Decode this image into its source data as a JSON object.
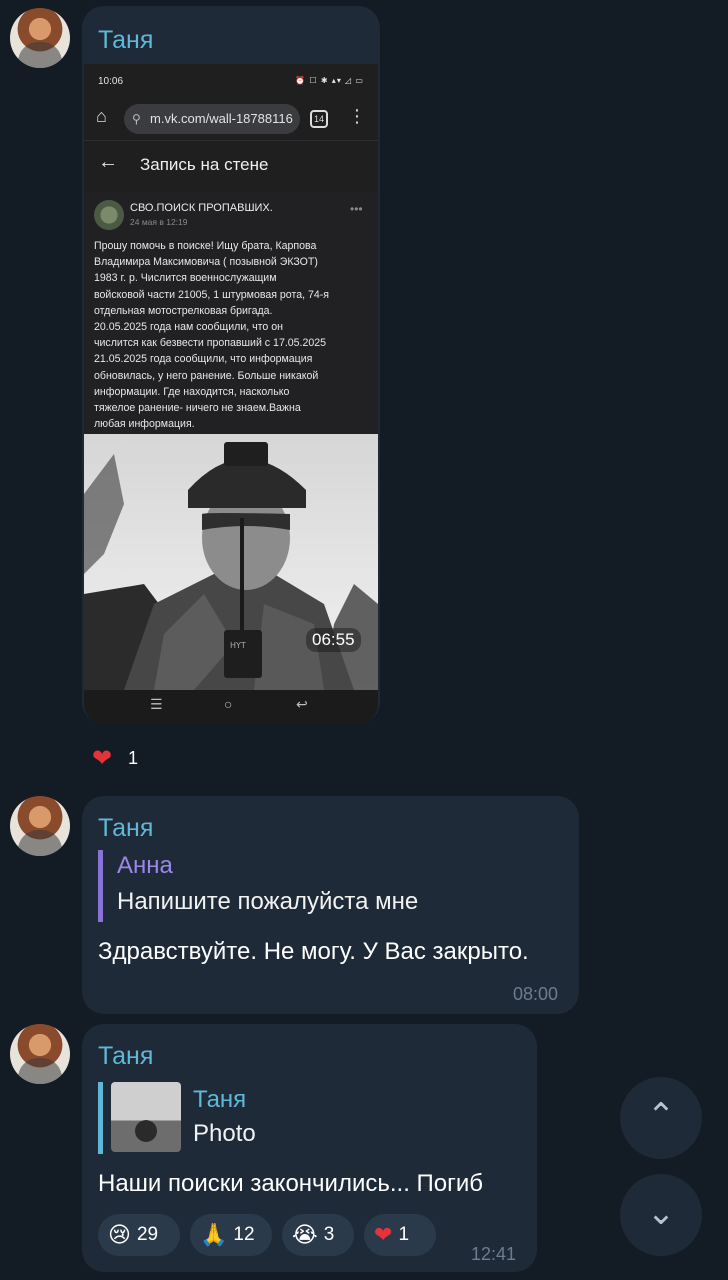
{
  "colors": {
    "background": "#131b24",
    "bubble": "#1e2a38",
    "sender": "#5fb8d8",
    "reply_accent": "#8a73d6",
    "time": "#6d7d8e",
    "heart": "#e5323b"
  },
  "messages": [
    {
      "sender": "Таня",
      "screenshot": {
        "status_time": "10:06",
        "status_icons": "⏰ ☐ ✱ ▴▾ ◿ ▭",
        "url": "m.vk.com/wall-18788116",
        "tabs_count": "14",
        "page_title": "Запись на стене",
        "group_name": "СВО.ПОИСК ПРОПАВШИХ.",
        "post_date": "24 мая в 12:19",
        "post_text": "Прошу помочь в поиске! Ищу брата, Карпова\nВладимира Максимовича ( позывной ЭКЗОТ)\n1983 г. р. Числится военнослужащим\nвойсковой части 21005, 1 штурмовая рота, 74-я\nотдельная мотострелковая бригада.\n20.05.2025 года нам сообщили, что он\nчислится как безвести пропавший с 17.05.2025\n21.05.2025 года сообщили, что информация\nобновилась, у него ранение. Больше никакой\nинформации. Где находится, насколько\nтяжелое ранение- ничего не знаем.Важна\nлюбая информация.",
        "duration": "06:55"
      },
      "reactions": [
        {
          "icon": "heart-icon",
          "emoji": "❤",
          "count": "1"
        }
      ]
    },
    {
      "sender": "Таня",
      "reply_to": {
        "name": "Анна",
        "text": "Напишите пожалуйста мне"
      },
      "text": "Здравствуйте. Не могу. У Вас закрыто.",
      "time": "08:00"
    },
    {
      "sender": "Таня",
      "reply_to": {
        "name": "Таня",
        "text": "Photo"
      },
      "text": "Наши поиски закончились... Погиб",
      "time": "12:41",
      "reactions": [
        {
          "icon": "crying-face-icon",
          "emoji": "😢",
          "count": "29"
        },
        {
          "icon": "folded-hands-icon",
          "emoji": "🙏",
          "count": "12"
        },
        {
          "icon": "loudly-crying-face-icon",
          "emoji": "😭",
          "count": "3"
        },
        {
          "icon": "heart-icon",
          "emoji": "❤",
          "count": "1"
        }
      ]
    }
  ],
  "scroll_buttons": {
    "up": "⌃",
    "down": "⌄"
  }
}
